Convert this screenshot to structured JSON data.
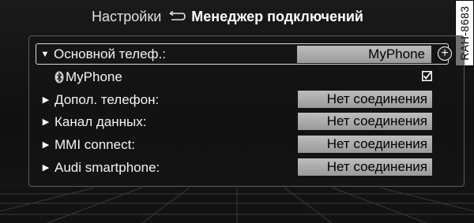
{
  "header": {
    "breadcrumb": "Настройки",
    "title": "Менеджер подключений"
  },
  "side_code": "RAH-8683",
  "rows": [
    {
      "label": "Основной телеф.:",
      "value": "MyPhone",
      "expanded": true
    },
    {
      "label": "MyPhone",
      "checked": true
    },
    {
      "label": "Допол. телефон:",
      "value": "Нет соединения"
    },
    {
      "label": "Канал данных:",
      "value": "Нет соединения"
    },
    {
      "label": "MMI connect:",
      "value": "Нет соединения"
    },
    {
      "label": "Audi smartphone:",
      "value": "Нет соединения"
    }
  ],
  "icons": {
    "back": "back-arrow-icon",
    "expand_open": "triangle-down-icon",
    "expand_closed": "triangle-right-icon",
    "bluetooth": "bluetooth-icon",
    "add": "plus-icon",
    "check": "checkbox-checked-icon"
  },
  "add_button_glyph": "+"
}
